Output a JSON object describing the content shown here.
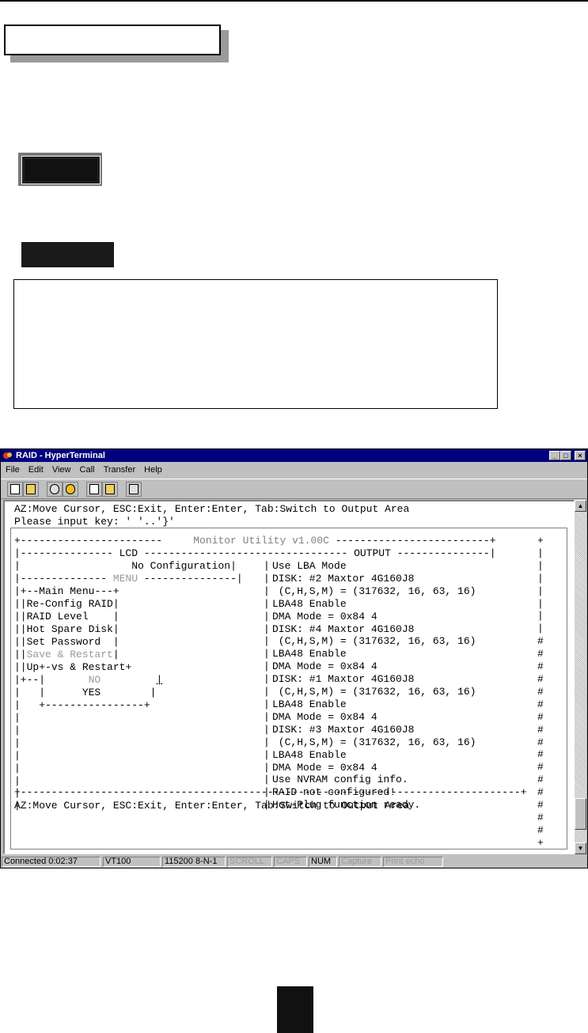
{
  "window": {
    "title": "RAID - HyperTerminal",
    "controls": [
      "_",
      "□",
      "×"
    ]
  },
  "menu": [
    "File",
    "Edit",
    "View",
    "Call",
    "Transfer",
    "Help"
  ],
  "toolbar_icons": [
    "new-icon",
    "open-icon",
    "call-icon",
    "disconnect-icon",
    "send-icon",
    "receive-icon",
    "properties-icon"
  ],
  "terminal": {
    "top_line1": "AZ:Move Cursor, ESC:Exit, Enter:Enter, Tab:Switch to Output Area",
    "top_line2": "Please input key: ' '..'}'",
    "header": "Monitor Utility v1.00C",
    "lcd_label": "LCD",
    "output_label": "OUTPUT",
    "lcd_text": "No Configuration",
    "menu_label": "MENU",
    "main_menu": "Main Menu",
    "menu_items": [
      "Re-Config RAID",
      "RAID Level",
      "Hot Spare Disk",
      "Set Password",
      "Save & Restart",
      "Up+-vs & Restart"
    ],
    "confirm_no": "NO",
    "confirm_yes": "YES",
    "output_lines": [
      "Use LBA Mode",
      "DISK: #2 Maxtor 4G160J8",
      " (C,H,S,M) = (317632, 16, 63, 16)",
      "LBA48 Enable",
      "DMA Mode = 0x84 4",
      "DISK: #4 Maxtor 4G160J8",
      " (C,H,S,M) = (317632, 16, 63, 16)",
      "LBA48 Enable",
      "DMA Mode = 0x84 4",
      "DISK: #1 Maxtor 4G160J8",
      " (C,H,S,M) = (317632, 16, 63, 16)",
      "LBA48 Enable",
      "DMA Mode = 0x84 4",
      "DISK: #3 Maxtor 4G160J8",
      " (C,H,S,M) = (317632, 16, 63, 16)",
      "LBA48 Enable",
      "DMA Mode = 0x84 4",
      "Use NVRAM config info.",
      "RAID not configured!",
      "Hot-Plug function ready."
    ],
    "bottom_line": "AZ:Move Cursor, ESC:Exit, Enter:Enter, Tab:Switch to Output Area"
  },
  "status": [
    "Connected 0:02:37",
    "VT100",
    "115200 8-N-1",
    "SCROLL",
    "CAPS",
    "NUM",
    "Capture",
    "Print echo"
  ]
}
